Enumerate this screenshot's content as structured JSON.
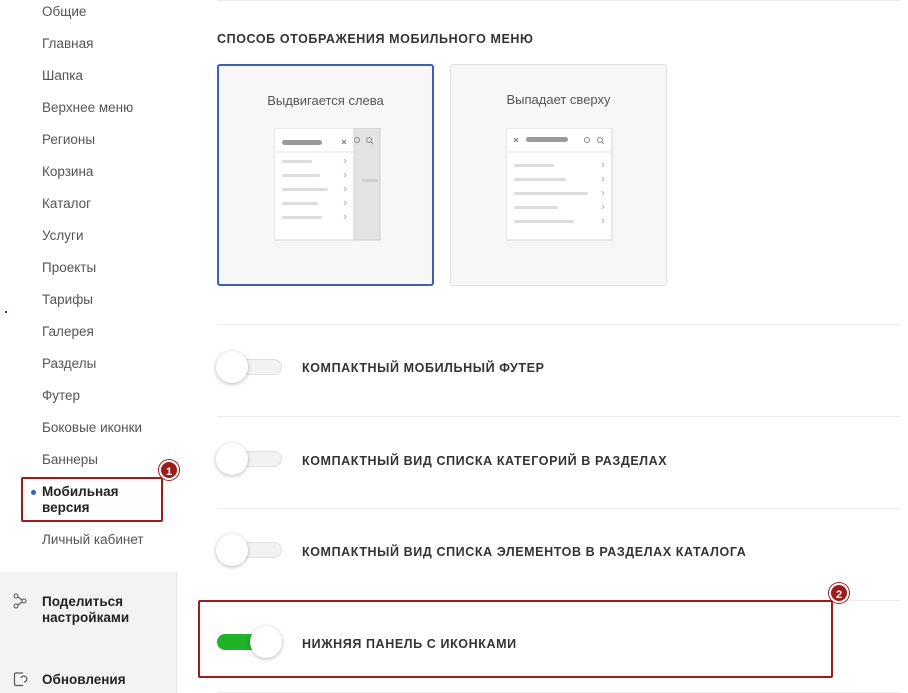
{
  "sidebar": {
    "items": [
      {
        "label": "Общие"
      },
      {
        "label": "Главная"
      },
      {
        "label": "Шапка"
      },
      {
        "label": "Верхнее меню"
      },
      {
        "label": "Регионы"
      },
      {
        "label": "Корзина"
      },
      {
        "label": "Каталог"
      },
      {
        "label": "Услуги"
      },
      {
        "label": "Проекты"
      },
      {
        "label": "Тарифы"
      },
      {
        "label": "Галерея"
      },
      {
        "label": "Разделы"
      },
      {
        "label": "Футер"
      },
      {
        "label": "Боковые иконки"
      },
      {
        "label": "Баннеры"
      },
      {
        "label": "Мобильная версия",
        "line1": "Мобильная",
        "line2": "версия",
        "active": true
      },
      {
        "label": "Личный кабинет"
      }
    ],
    "footer": {
      "share_line1": "Поделиться",
      "share_line2": "настройками",
      "share_icon": "share-icon",
      "updates_label": "Обновления",
      "updates_icon": "update-icon"
    }
  },
  "annotations": {
    "badge1": "1",
    "badge2": "2",
    "color": "#9e1b1b"
  },
  "main": {
    "section_title": "СПОСОБ ОТОБРАЖЕНИЯ МОБИЛЬНОГО МЕНЮ",
    "menu_options": [
      {
        "label": "Выдвигается слева",
        "selected": true
      },
      {
        "label": "Выпадает сверху",
        "selected": false
      }
    ],
    "toggles": [
      {
        "label": "КОМПАКТНЫЙ МОБИЛЬНЫЙ ФУТЕР",
        "on": false
      },
      {
        "label": "КОМПАКТНЫЙ ВИД СПИСКА КАТЕГОРИЙ В РАЗДЕЛАХ",
        "on": false
      },
      {
        "label": "КОМПАКТНЫЙ ВИД СПИСКА ЭЛЕМЕНТОВ В РАЗДЕЛАХ КАТАЛОГА",
        "on": false
      },
      {
        "label": "НИЖНЯЯ ПАНЕЛЬ С ИКОНКАМИ",
        "on": true
      }
    ]
  },
  "colors": {
    "accent_selected": "#3d5fb5",
    "toggle_on": "#1fb32a"
  }
}
